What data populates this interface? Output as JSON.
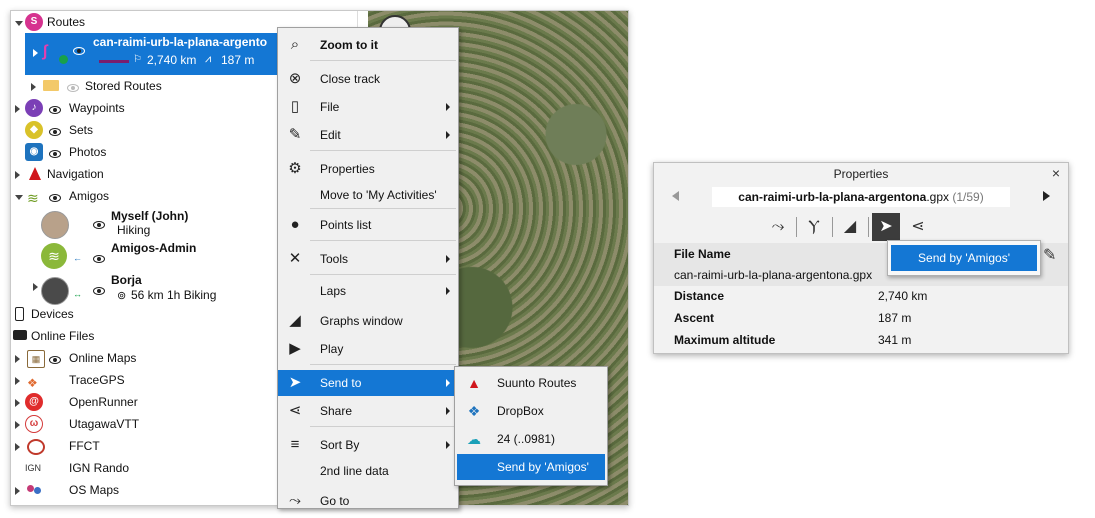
{
  "tree": {
    "routes": {
      "label": "Routes"
    },
    "selected_route": {
      "name": "can-raimi-urb-la-plana-argento",
      "distance": "2,740 km",
      "ascent": "187 m"
    },
    "stored_routes": {
      "label": "Stored Routes"
    },
    "waypoints": {
      "label": "Waypoints"
    },
    "sets": {
      "label": "Sets"
    },
    "photos": {
      "label": "Photos"
    },
    "navigation": {
      "label": "Navigation"
    },
    "amigos": {
      "label": "Amigos"
    },
    "myself": {
      "name": "Myself (John)",
      "status": "Hiking"
    },
    "amigos_admin": {
      "name": "Amigos-Admin"
    },
    "borja": {
      "name": "Borja",
      "status": "56 km 1h Biking"
    },
    "devices": {
      "label": "Devices"
    },
    "online_files": {
      "label": "Online Files"
    },
    "online_maps": {
      "label": "Online Maps"
    },
    "tracegps": {
      "label": "TraceGPS"
    },
    "openrunner": {
      "label": "OpenRunner"
    },
    "utagawavtt": {
      "label": "UtagawaVTT"
    },
    "ffct": {
      "label": "FFCT"
    },
    "ign_rando": {
      "label": "IGN Rando",
      "badge": "IGN"
    },
    "os_maps": {
      "label": "OS Maps"
    }
  },
  "context_menu": {
    "zoom": "Zoom to it",
    "close_track": "Close track",
    "file": "File",
    "edit": "Edit",
    "properties": "Properties",
    "move_to": "Move to 'My Activities'",
    "points_list": "Points list",
    "tools": "Tools",
    "laps": "Laps",
    "graphs_window": "Graphs window",
    "play": "Play",
    "send_to": "Send to",
    "share": "Share",
    "sort_by": "Sort By",
    "second_line": "2nd line data",
    "go_to": "Go to"
  },
  "submenu": {
    "suunto": "Suunto Routes",
    "dropbox": "DropBox",
    "device": "24 (..0981)",
    "amigos": "Send by 'Amigos'"
  },
  "properties": {
    "title": "Properties",
    "close": "×",
    "filename": "can-raimi-urb-la-plana-argentona",
    "extension": ".gpx",
    "counter": "(1/59)",
    "popup_item": "Send by 'Amigos'",
    "file_name_label": "File Name",
    "file_name_value": "can-raimi-urb-la-plana-argentona.gpx",
    "distance_label": "Distance",
    "distance_value": "2,740 km",
    "ascent_label": "Ascent",
    "ascent_value": "187 m",
    "max_alt_label": "Maximum altitude",
    "max_alt_value": "341 m"
  }
}
